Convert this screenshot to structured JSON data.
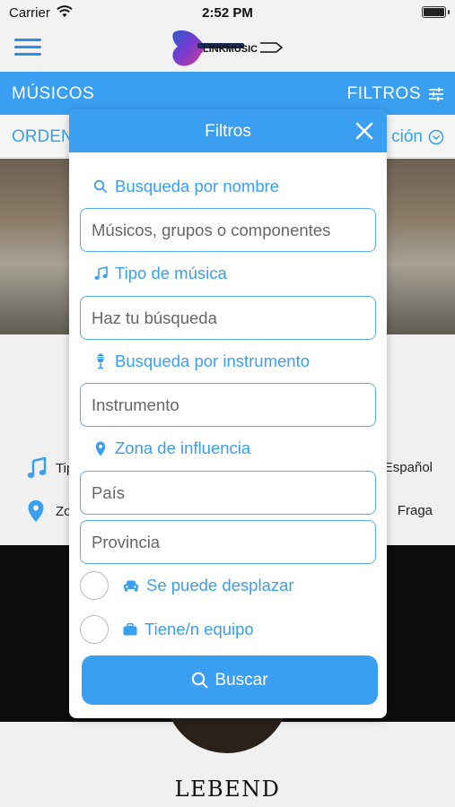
{
  "status_bar": {
    "carrier": "Carrier",
    "time": "2:52 PM"
  },
  "nav": {
    "logo_text": "LINKMUSIC"
  },
  "section": {
    "title": "MÚSICOS",
    "filters_label": "FILTROS"
  },
  "sort": {
    "left_label": "ORDEN",
    "right_label": "ción"
  },
  "background_card": {
    "row1_left": "Tip",
    "row1_right": "Español",
    "row2_left": "Zo",
    "row2_right": "Fraga",
    "band_name": "LEBEND"
  },
  "modal": {
    "title": "Filtros",
    "name_label": "Busqueda por nombre",
    "name_placeholder": "Músicos, grupos o componentes",
    "music_type_label": "Tipo de música",
    "music_type_placeholder": "Haz tu búsqueda",
    "instrument_label": "Busqueda por instrumento",
    "instrument_placeholder": "Instrumento",
    "zone_label": "Zona de influencia",
    "country_placeholder": "País",
    "province_placeholder": "Provincia",
    "travel_label": "Se puede desplazar",
    "equipment_label": "Tiene/n equipo",
    "search_button": "Buscar"
  },
  "colors": {
    "accent": "#3a9ff0",
    "border": "#5aaef0"
  },
  "icons": [
    "wifi-icon",
    "battery-icon",
    "menu-icon",
    "filter-sliders-icon",
    "chevron-down-circle-icon",
    "close-icon",
    "search-icon",
    "music-note-icon",
    "microphone-icon",
    "location-pin-icon",
    "car-icon",
    "briefcase-icon"
  ]
}
